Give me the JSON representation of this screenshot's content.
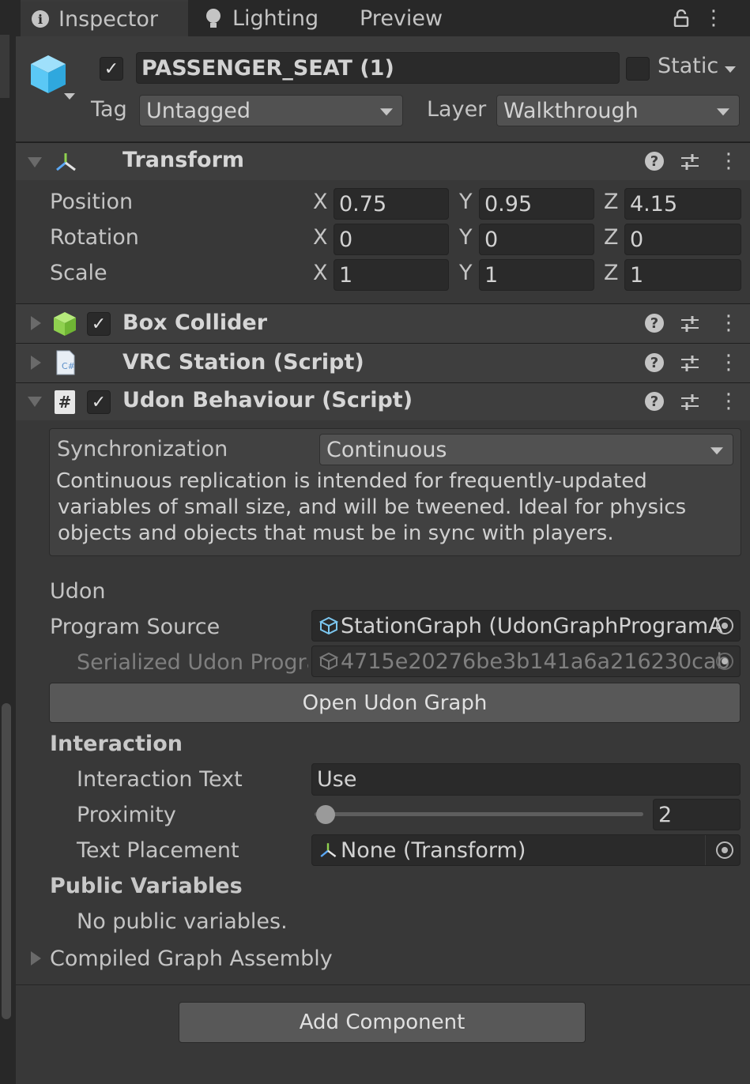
{
  "tabs": [
    {
      "label": "Inspector"
    },
    {
      "label": "Lighting"
    },
    {
      "label": "Preview"
    }
  ],
  "gameobject": {
    "name": "PASSENGER_SEAT (1)",
    "active": true,
    "static_label": "Static",
    "tag_label": "Tag",
    "tag_value": "Untagged",
    "layer_label": "Layer",
    "layer_value": "Walkthrough"
  },
  "transform": {
    "title": "Transform",
    "rows": [
      {
        "label": "Position",
        "x": "0.75",
        "y": "0.95",
        "z": "4.15"
      },
      {
        "label": "Rotation",
        "x": "0",
        "y": "0",
        "z": "0"
      },
      {
        "label": "Scale",
        "x": "1",
        "y": "1",
        "z": "1"
      }
    ],
    "axes": [
      "X",
      "Y",
      "Z"
    ]
  },
  "components": {
    "box_collider": "Box Collider",
    "vrc_station": "VRC Station (Script)",
    "udon_behaviour": "Udon Behaviour (Script)"
  },
  "udon": {
    "sync_label": "Synchronization",
    "sync_value": "Continuous",
    "sync_description": "Continuous replication is intended for frequently-updated variables of small size, and will be tweened. Ideal for physics objects and objects that must be in sync with players.",
    "udon_header": "Udon",
    "program_source_label": "Program Source",
    "program_source_value": "StationGraph (UdonGraphProgramA",
    "serialized_label": "Serialized Udon Progra",
    "serialized_value": "4715e20276be3b141a6a216230cab",
    "open_graph_button": "Open Udon Graph",
    "interaction_header": "Interaction",
    "interaction_text_label": "Interaction Text",
    "interaction_text_value": "Use",
    "proximity_label": "Proximity",
    "proximity_value": "2",
    "proximity_slider_fraction": 0.0,
    "text_placement_label": "Text Placement",
    "text_placement_value": "None (Transform)",
    "public_vars_header": "Public Variables",
    "no_public_vars": "No public variables.",
    "compiled_assembly": "Compiled Graph Assembly"
  },
  "add_component_button": "Add Component",
  "icons": {
    "info": "i",
    "help": "?",
    "kebab": "⋮",
    "check": "✓",
    "hash": "#"
  },
  "colors": {
    "background": "#383838",
    "field": "#2a2a2a",
    "button": "#585858",
    "collider_green": "#8fd14f",
    "gameobject_blue": "#5bc8f5"
  }
}
